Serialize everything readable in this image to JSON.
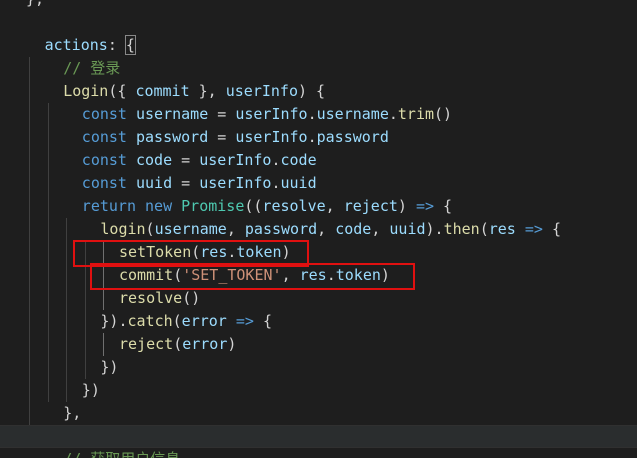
{
  "editor": {
    "lines": [
      [
        {
          "t": "},",
          "c": "pun"
        }
      ],
      [],
      [
        {
          "t": "actions",
          "c": "prop"
        },
        {
          "t": ": ",
          "c": "pun"
        },
        {
          "t": "{",
          "c": "pun",
          "m": true
        }
      ],
      [
        {
          "t": "// 登录",
          "c": "cmt"
        }
      ],
      [
        {
          "t": "Login",
          "c": "fn"
        },
        {
          "t": "({ ",
          "c": "pun"
        },
        {
          "t": "commit",
          "c": "var"
        },
        {
          "t": " }, ",
          "c": "pun"
        },
        {
          "t": "userInfo",
          "c": "var"
        },
        {
          "t": ") {",
          "c": "pun"
        }
      ],
      [
        {
          "t": "const ",
          "c": "kw"
        },
        {
          "t": "username",
          "c": "var"
        },
        {
          "t": " = ",
          "c": "op"
        },
        {
          "t": "userInfo",
          "c": "var"
        },
        {
          "t": ".",
          "c": "pun"
        },
        {
          "t": "username",
          "c": "prop"
        },
        {
          "t": ".",
          "c": "pun"
        },
        {
          "t": "trim",
          "c": "fn"
        },
        {
          "t": "()",
          "c": "pun"
        }
      ],
      [
        {
          "t": "const ",
          "c": "kw"
        },
        {
          "t": "password",
          "c": "var"
        },
        {
          "t": " = ",
          "c": "op"
        },
        {
          "t": "userInfo",
          "c": "var"
        },
        {
          "t": ".",
          "c": "pun"
        },
        {
          "t": "password",
          "c": "prop"
        }
      ],
      [
        {
          "t": "const ",
          "c": "kw"
        },
        {
          "t": "code",
          "c": "var"
        },
        {
          "t": " = ",
          "c": "op"
        },
        {
          "t": "userInfo",
          "c": "var"
        },
        {
          "t": ".",
          "c": "pun"
        },
        {
          "t": "code",
          "c": "prop"
        }
      ],
      [
        {
          "t": "const ",
          "c": "kw"
        },
        {
          "t": "uuid",
          "c": "var"
        },
        {
          "t": " = ",
          "c": "op"
        },
        {
          "t": "userInfo",
          "c": "var"
        },
        {
          "t": ".",
          "c": "pun"
        },
        {
          "t": "uuid",
          "c": "prop"
        }
      ],
      [
        {
          "t": "return ",
          "c": "kw"
        },
        {
          "t": "new ",
          "c": "kw"
        },
        {
          "t": "Promise",
          "c": "cls"
        },
        {
          "t": "((",
          "c": "pun"
        },
        {
          "t": "resolve",
          "c": "var"
        },
        {
          "t": ", ",
          "c": "pun"
        },
        {
          "t": "reject",
          "c": "var"
        },
        {
          "t": ") ",
          "c": "pun"
        },
        {
          "t": "=>",
          "c": "kw"
        },
        {
          "t": " {",
          "c": "pun"
        }
      ],
      [
        {
          "t": "login",
          "c": "fn"
        },
        {
          "t": "(",
          "c": "pun"
        },
        {
          "t": "username",
          "c": "var"
        },
        {
          "t": ", ",
          "c": "pun"
        },
        {
          "t": "password",
          "c": "var"
        },
        {
          "t": ", ",
          "c": "pun"
        },
        {
          "t": "code",
          "c": "var"
        },
        {
          "t": ", ",
          "c": "pun"
        },
        {
          "t": "uuid",
          "c": "var"
        },
        {
          "t": ").",
          "c": "pun"
        },
        {
          "t": "then",
          "c": "fn"
        },
        {
          "t": "(",
          "c": "pun"
        },
        {
          "t": "res",
          "c": "var"
        },
        {
          "t": " => ",
          "c": "kw"
        },
        {
          "t": "{",
          "c": "pun"
        }
      ],
      [
        {
          "t": "setToken",
          "c": "fn"
        },
        {
          "t": "(",
          "c": "pun"
        },
        {
          "t": "res",
          "c": "var"
        },
        {
          "t": ".",
          "c": "pun"
        },
        {
          "t": "token",
          "c": "prop"
        },
        {
          "t": ")",
          "c": "pun"
        }
      ],
      [
        {
          "t": "commit",
          "c": "fn"
        },
        {
          "t": "(",
          "c": "pun"
        },
        {
          "t": "'SET_TOKEN'",
          "c": "str"
        },
        {
          "t": ", ",
          "c": "pun"
        },
        {
          "t": "res",
          "c": "var"
        },
        {
          "t": ".",
          "c": "pun"
        },
        {
          "t": "token",
          "c": "prop"
        },
        {
          "t": ")",
          "c": "pun"
        }
      ],
      [
        {
          "t": "resolve",
          "c": "fn"
        },
        {
          "t": "()",
          "c": "pun"
        }
      ],
      [
        {
          "t": "}).",
          "c": "pun"
        },
        {
          "t": "catch",
          "c": "fn"
        },
        {
          "t": "(",
          "c": "pun"
        },
        {
          "t": "error",
          "c": "var"
        },
        {
          "t": " => ",
          "c": "kw"
        },
        {
          "t": "{",
          "c": "pun"
        }
      ],
      [
        {
          "t": "reject",
          "c": "fn"
        },
        {
          "t": "(",
          "c": "pun"
        },
        {
          "t": "error",
          "c": "var"
        },
        {
          "t": ")",
          "c": "pun"
        }
      ],
      [
        {
          "t": "})",
          "c": "pun"
        }
      ],
      [
        {
          "t": "})",
          "c": "pun"
        }
      ],
      [
        {
          "t": "},",
          "c": "pun"
        }
      ],
      [],
      [
        {
          "t": "// 获取用户信息",
          "c": "cmt"
        }
      ]
    ],
    "indents": [
      0,
      0,
      1,
      2,
      2,
      3,
      3,
      3,
      3,
      3,
      4,
      5,
      5,
      5,
      4,
      5,
      4,
      3,
      2,
      0,
      2
    ]
  }
}
